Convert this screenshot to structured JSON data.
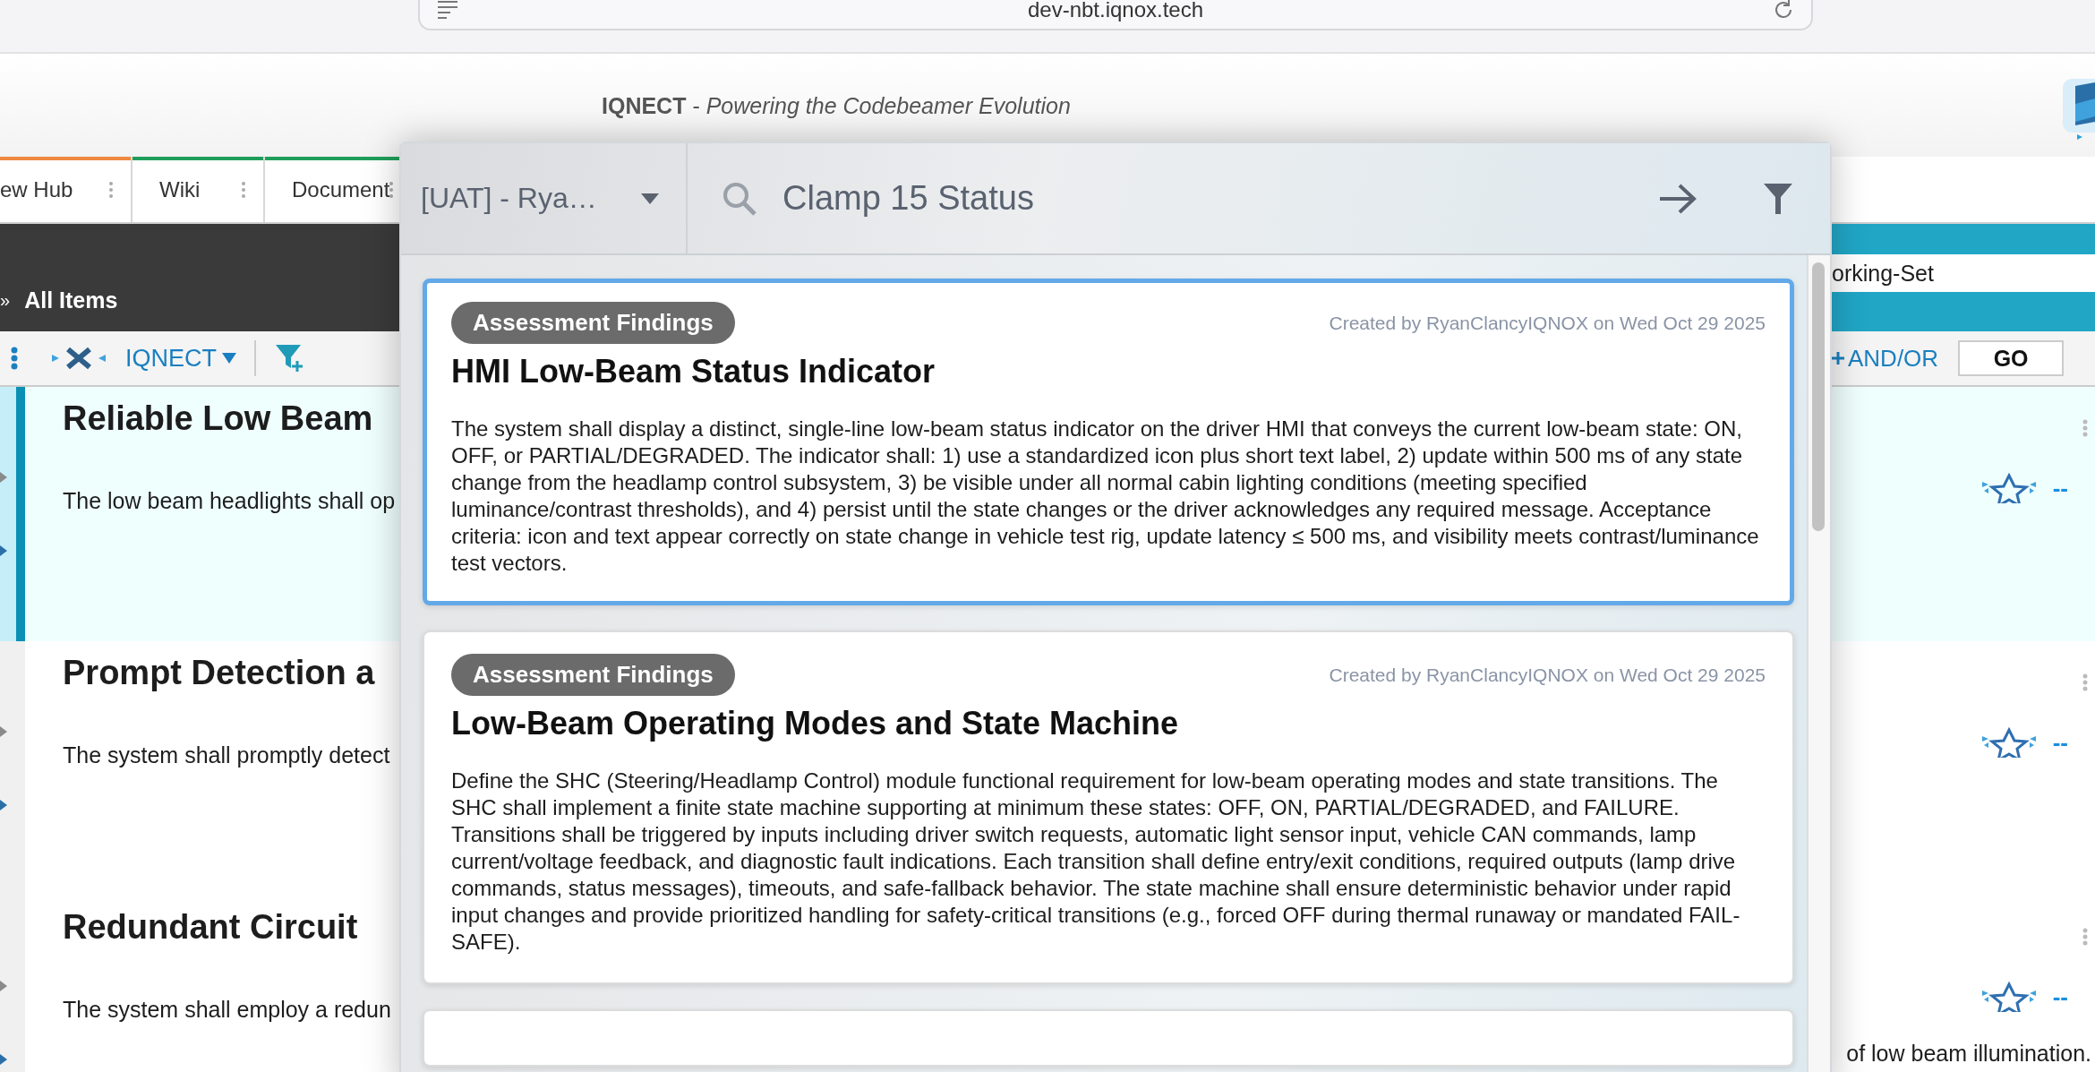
{
  "browser": {
    "url": "dev-nbt.iqnox.tech"
  },
  "header": {
    "title": "**IQNECT** - *Powering the Codebeamer Evolution*"
  },
  "tabs": [
    {
      "label": "ew Hub",
      "color": "#f0883e"
    },
    {
      "label": "Wiki",
      "color": "#1f9e5a"
    },
    {
      "label": "Document",
      "color": "#1f9e5a"
    }
  ],
  "breadcrumb": {
    "separator": "»",
    "label": "All Items"
  },
  "toolbar": {
    "menu": "IQNECT"
  },
  "working_set": {
    "value": "orking-Set"
  },
  "query": {
    "and_or": "AND/OR",
    "go": "GO"
  },
  "rows": [
    {
      "title": "Reliable Low Beam",
      "text": "The low beam headlights shall op",
      "rating": "--",
      "selected": true
    },
    {
      "title": "Prompt Detection a",
      "text": "The system shall promptly detect",
      "rating": "--",
      "selected": false
    },
    {
      "title": "Redundant Circuit",
      "text": "The system shall employ a redun",
      "text_end": "of low beam illumination.",
      "rating": "--",
      "selected": false
    }
  ],
  "search_popup": {
    "project": "[UAT] - Rya…",
    "query": "Clamp 15 Status",
    "results": [
      {
        "badge": "Assessment Findings",
        "meta": "Created by RyanClancyIQNOX on Wed Oct 29 2025",
        "title": "HMI Low-Beam Status Indicator",
        "description": "The system shall display a distinct, single-line low-beam status indicator on the driver HMI that conveys the current low-beam state: ON, OFF, or PARTIAL/DEGRADED. The indicator shall: 1) use a standardized icon plus short text label, 2) update within 500 ms of any state change from the headlamp control subsystem, 3) be visible under all normal cabin lighting conditions (meeting specified luminance/contrast thresholds), and 4) persist until the state changes or the driver acknowledges any required message. Acceptance criteria: icon and text appear correctly on state change in vehicle test rig, update latency ≤ 500 ms, and visibility meets contrast/luminance test vectors.",
        "selected": true
      },
      {
        "badge": "Assessment Findings",
        "meta": "Created by RyanClancyIQNOX on Wed Oct 29 2025",
        "title": "Low-Beam Operating Modes and State Machine",
        "description": "Define the SHC (Steering/Headlamp Control) module functional requirement for low-beam operating modes and state transitions. The SHC shall implement a finite state machine supporting at minimum these states: OFF, ON, PARTIAL/DEGRADED, and FAILURE. Transitions shall be triggered by inputs including driver switch requests, automatic light sensor input, vehicle CAN commands, lamp current/voltage feedback, and diagnostic fault indications. Each transition shall define entry/exit conditions, required outputs (lamp drive commands, status messages), timeouts, and safe-fallback behavior. The state machine shall ensure deterministic behavior under rapid input changes and provide prioritized handling for safety-critical transitions (e.g., forced OFF during thermal runaway or mandated FAIL-SAFE).",
        "selected": false
      }
    ]
  }
}
